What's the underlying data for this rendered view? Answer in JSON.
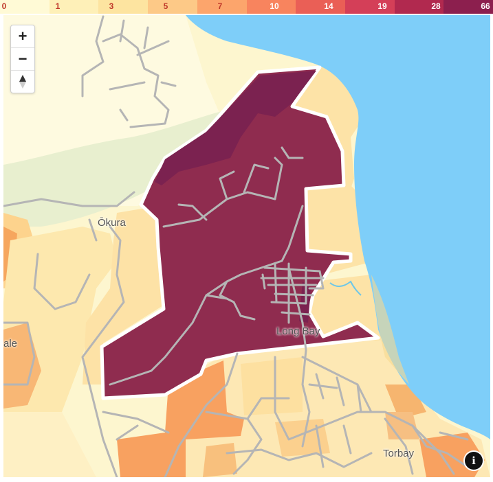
{
  "legend": {
    "labels": [
      "0",
      "1",
      "3",
      "5",
      "7",
      "10",
      "14",
      "19",
      "28",
      "66"
    ],
    "colors": [
      "#fffad6",
      "#fef0b8",
      "#fde4a0",
      "#fdc987",
      "#fca56c",
      "#f8845e",
      "#ea5f56",
      "#d43f58",
      "#b1294f",
      "#8c1f4e"
    ]
  },
  "zoom": {
    "in": "+",
    "out": "−"
  },
  "places": {
    "okura": "Ōkura",
    "long_bay": "Long Bay",
    "torbay": "Torbay",
    "dale": "ale"
  },
  "info_glyph": "i",
  "colors": {
    "water": "#7ecef9",
    "highlight": "#8f2c4f",
    "highlight_dark": "#7b2250",
    "roads": "#b5b5b5",
    "park": "#e8efcf"
  }
}
